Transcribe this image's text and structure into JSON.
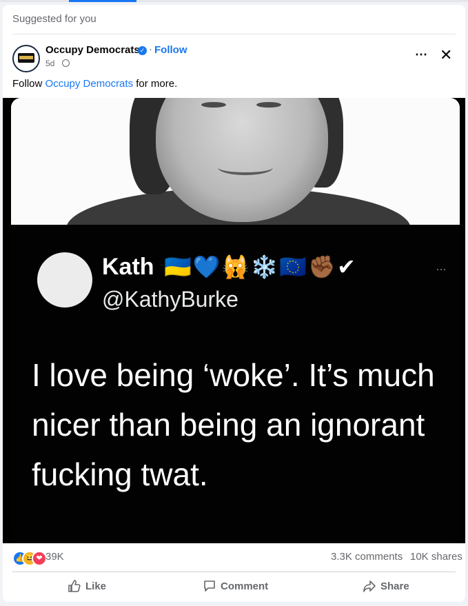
{
  "feed": {
    "suggested_label": "Suggested for you"
  },
  "post": {
    "page_name": "Occupy Democrats",
    "follow_label": "Follow",
    "time": "5d",
    "dot_sep": "·",
    "caption_prefix": "Follow",
    "caption_link": "Occupy Democrats",
    "caption_suffix": "for more.",
    "more_icon": "⋯",
    "close_icon": "✕"
  },
  "tweet": {
    "name": "Kath",
    "emojis": "🇺🇦💙🙀❄️🇪🇺✊🏾✔",
    "handle": "@KathyBurke",
    "text": "I love being ‘woke’. It’s much nicer than being an ignorant fucking twat.",
    "more": "···"
  },
  "stats": {
    "reactions_count": "39K",
    "comments": "3.3K comments",
    "shares": "10K shares"
  },
  "actions": {
    "like": "Like",
    "comment": "Comment",
    "share": "Share"
  },
  "colors": {
    "link": "#1877f2",
    "muted": "#65676b",
    "background": "#f0f2f5"
  }
}
